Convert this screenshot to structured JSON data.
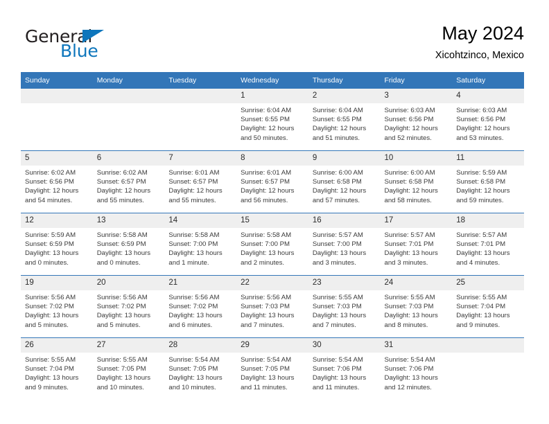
{
  "branding": {
    "logo_text_primary": "General",
    "logo_text_secondary": "Blue",
    "logo_accent_color": "#0e76bc"
  },
  "header": {
    "title": "May 2024",
    "subtitle": "Xicohtzinco, Mexico"
  },
  "theme": {
    "header_blue": "#3376b8",
    "daynum_band": "#efefef",
    "text": "#3a3a3a"
  },
  "weekday_headers": [
    "Sunday",
    "Monday",
    "Tuesday",
    "Wednesday",
    "Thursday",
    "Friday",
    "Saturday"
  ],
  "labels": {
    "sunrise_prefix": "Sunrise:",
    "sunset_prefix": "Sunset:",
    "daylight_prefix": "Daylight:"
  },
  "weeks": [
    [
      {
        "day": "",
        "empty": true
      },
      {
        "day": "",
        "empty": true
      },
      {
        "day": "",
        "empty": true
      },
      {
        "day": "1",
        "sunrise": "Sunrise: 6:04 AM",
        "sunset": "Sunset: 6:55 PM",
        "daylight_line1": "Daylight: 12 hours",
        "daylight_line2": "and 50 minutes."
      },
      {
        "day": "2",
        "sunrise": "Sunrise: 6:04 AM",
        "sunset": "Sunset: 6:55 PM",
        "daylight_line1": "Daylight: 12 hours",
        "daylight_line2": "and 51 minutes."
      },
      {
        "day": "3",
        "sunrise": "Sunrise: 6:03 AM",
        "sunset": "Sunset: 6:56 PM",
        "daylight_line1": "Daylight: 12 hours",
        "daylight_line2": "and 52 minutes."
      },
      {
        "day": "4",
        "sunrise": "Sunrise: 6:03 AM",
        "sunset": "Sunset: 6:56 PM",
        "daylight_line1": "Daylight: 12 hours",
        "daylight_line2": "and 53 minutes."
      }
    ],
    [
      {
        "day": "5",
        "sunrise": "Sunrise: 6:02 AM",
        "sunset": "Sunset: 6:56 PM",
        "daylight_line1": "Daylight: 12 hours",
        "daylight_line2": "and 54 minutes."
      },
      {
        "day": "6",
        "sunrise": "Sunrise: 6:02 AM",
        "sunset": "Sunset: 6:57 PM",
        "daylight_line1": "Daylight: 12 hours",
        "daylight_line2": "and 55 minutes."
      },
      {
        "day": "7",
        "sunrise": "Sunrise: 6:01 AM",
        "sunset": "Sunset: 6:57 PM",
        "daylight_line1": "Daylight: 12 hours",
        "daylight_line2": "and 55 minutes."
      },
      {
        "day": "8",
        "sunrise": "Sunrise: 6:01 AM",
        "sunset": "Sunset: 6:57 PM",
        "daylight_line1": "Daylight: 12 hours",
        "daylight_line2": "and 56 minutes."
      },
      {
        "day": "9",
        "sunrise": "Sunrise: 6:00 AM",
        "sunset": "Sunset: 6:58 PM",
        "daylight_line1": "Daylight: 12 hours",
        "daylight_line2": "and 57 minutes."
      },
      {
        "day": "10",
        "sunrise": "Sunrise: 6:00 AM",
        "sunset": "Sunset: 6:58 PM",
        "daylight_line1": "Daylight: 12 hours",
        "daylight_line2": "and 58 minutes."
      },
      {
        "day": "11",
        "sunrise": "Sunrise: 5:59 AM",
        "sunset": "Sunset: 6:58 PM",
        "daylight_line1": "Daylight: 12 hours",
        "daylight_line2": "and 59 minutes."
      }
    ],
    [
      {
        "day": "12",
        "sunrise": "Sunrise: 5:59 AM",
        "sunset": "Sunset: 6:59 PM",
        "daylight_line1": "Daylight: 13 hours",
        "daylight_line2": "and 0 minutes."
      },
      {
        "day": "13",
        "sunrise": "Sunrise: 5:58 AM",
        "sunset": "Sunset: 6:59 PM",
        "daylight_line1": "Daylight: 13 hours",
        "daylight_line2": "and 0 minutes."
      },
      {
        "day": "14",
        "sunrise": "Sunrise: 5:58 AM",
        "sunset": "Sunset: 7:00 PM",
        "daylight_line1": "Daylight: 13 hours",
        "daylight_line2": "and 1 minute."
      },
      {
        "day": "15",
        "sunrise": "Sunrise: 5:58 AM",
        "sunset": "Sunset: 7:00 PM",
        "daylight_line1": "Daylight: 13 hours",
        "daylight_line2": "and 2 minutes."
      },
      {
        "day": "16",
        "sunrise": "Sunrise: 5:57 AM",
        "sunset": "Sunset: 7:00 PM",
        "daylight_line1": "Daylight: 13 hours",
        "daylight_line2": "and 3 minutes."
      },
      {
        "day": "17",
        "sunrise": "Sunrise: 5:57 AM",
        "sunset": "Sunset: 7:01 PM",
        "daylight_line1": "Daylight: 13 hours",
        "daylight_line2": "and 3 minutes."
      },
      {
        "day": "18",
        "sunrise": "Sunrise: 5:57 AM",
        "sunset": "Sunset: 7:01 PM",
        "daylight_line1": "Daylight: 13 hours",
        "daylight_line2": "and 4 minutes."
      }
    ],
    [
      {
        "day": "19",
        "sunrise": "Sunrise: 5:56 AM",
        "sunset": "Sunset: 7:02 PM",
        "daylight_line1": "Daylight: 13 hours",
        "daylight_line2": "and 5 minutes."
      },
      {
        "day": "20",
        "sunrise": "Sunrise: 5:56 AM",
        "sunset": "Sunset: 7:02 PM",
        "daylight_line1": "Daylight: 13 hours",
        "daylight_line2": "and 5 minutes."
      },
      {
        "day": "21",
        "sunrise": "Sunrise: 5:56 AM",
        "sunset": "Sunset: 7:02 PM",
        "daylight_line1": "Daylight: 13 hours",
        "daylight_line2": "and 6 minutes."
      },
      {
        "day": "22",
        "sunrise": "Sunrise: 5:56 AM",
        "sunset": "Sunset: 7:03 PM",
        "daylight_line1": "Daylight: 13 hours",
        "daylight_line2": "and 7 minutes."
      },
      {
        "day": "23",
        "sunrise": "Sunrise: 5:55 AM",
        "sunset": "Sunset: 7:03 PM",
        "daylight_line1": "Daylight: 13 hours",
        "daylight_line2": "and 7 minutes."
      },
      {
        "day": "24",
        "sunrise": "Sunrise: 5:55 AM",
        "sunset": "Sunset: 7:03 PM",
        "daylight_line1": "Daylight: 13 hours",
        "daylight_line2": "and 8 minutes."
      },
      {
        "day": "25",
        "sunrise": "Sunrise: 5:55 AM",
        "sunset": "Sunset: 7:04 PM",
        "daylight_line1": "Daylight: 13 hours",
        "daylight_line2": "and 9 minutes."
      }
    ],
    [
      {
        "day": "26",
        "sunrise": "Sunrise: 5:55 AM",
        "sunset": "Sunset: 7:04 PM",
        "daylight_line1": "Daylight: 13 hours",
        "daylight_line2": "and 9 minutes."
      },
      {
        "day": "27",
        "sunrise": "Sunrise: 5:55 AM",
        "sunset": "Sunset: 7:05 PM",
        "daylight_line1": "Daylight: 13 hours",
        "daylight_line2": "and 10 minutes."
      },
      {
        "day": "28",
        "sunrise": "Sunrise: 5:54 AM",
        "sunset": "Sunset: 7:05 PM",
        "daylight_line1": "Daylight: 13 hours",
        "daylight_line2": "and 10 minutes."
      },
      {
        "day": "29",
        "sunrise": "Sunrise: 5:54 AM",
        "sunset": "Sunset: 7:05 PM",
        "daylight_line1": "Daylight: 13 hours",
        "daylight_line2": "and 11 minutes."
      },
      {
        "day": "30",
        "sunrise": "Sunrise: 5:54 AM",
        "sunset": "Sunset: 7:06 PM",
        "daylight_line1": "Daylight: 13 hours",
        "daylight_line2": "and 11 minutes."
      },
      {
        "day": "31",
        "sunrise": "Sunrise: 5:54 AM",
        "sunset": "Sunset: 7:06 PM",
        "daylight_line1": "Daylight: 13 hours",
        "daylight_line2": "and 12 minutes."
      },
      {
        "day": "",
        "empty": true
      }
    ]
  ]
}
